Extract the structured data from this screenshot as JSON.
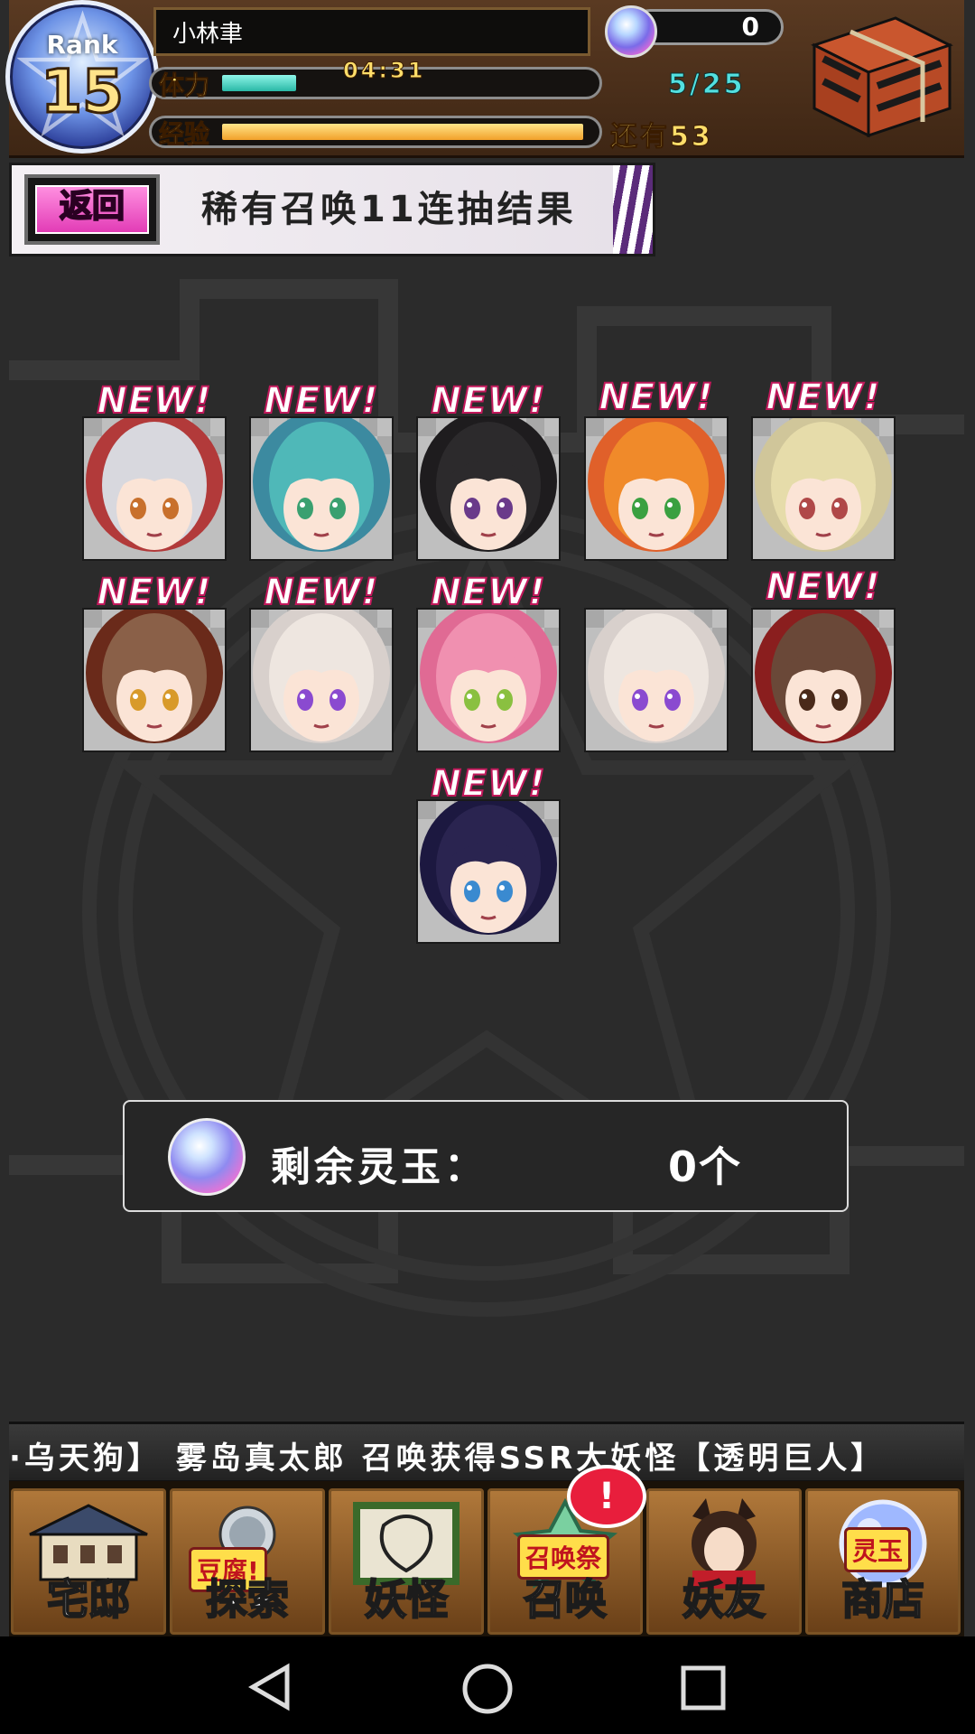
{
  "player": {
    "rank_label": "Rank",
    "rank_value": "15",
    "name": "小林聿",
    "stamina_label": "体力",
    "stamina_timer": "04:31",
    "stamina_value": "5/25",
    "stamina_fraction": 0.2,
    "exp_label": "经验",
    "exp_remaining": "还有53",
    "exp_fraction": 0.98,
    "orb_count": "0"
  },
  "banner": {
    "back_label": "返回",
    "title": "稀有召唤11连抽结果"
  },
  "results": {
    "new_label": "NEW!",
    "cards": [
      {
        "id": "card-1",
        "is_new": true,
        "hair": "#d8d8de",
        "hood": "#b23a3a",
        "eyes": "#c8702c"
      },
      {
        "id": "card-2",
        "is_new": true,
        "hair": "#4fb8b8",
        "hood": "#3c8aa0",
        "eyes": "#3aa070"
      },
      {
        "id": "card-3",
        "is_new": true,
        "hair": "#2c2a2c",
        "hood": "#1e1c1e",
        "eyes": "#6a3a8a"
      },
      {
        "id": "card-4",
        "is_new": true,
        "hair": "#f08a2a",
        "hood": "#e0602a",
        "eyes": "#3aa040"
      },
      {
        "id": "card-5",
        "is_new": true,
        "hair": "#e6dcaa",
        "hood": "#d0c69a",
        "eyes": "#b04848"
      },
      {
        "id": "card-6",
        "is_new": true,
        "hair": "#8a6048",
        "hood": "#6a2a1a",
        "eyes": "#d89a2a"
      },
      {
        "id": "card-7",
        "is_new": true,
        "hair": "#eee6e0",
        "hood": "#d8d0cc",
        "eyes": "#8a4ad0"
      },
      {
        "id": "card-8",
        "is_new": true,
        "hair": "#f090b0",
        "hood": "#e06a94",
        "eyes": "#8ac040"
      },
      {
        "id": "card-9",
        "is_new": false,
        "hair": "#eee6e0",
        "hood": "#d8d0cc",
        "eyes": "#8a4ad0"
      },
      {
        "id": "card-10",
        "is_new": true,
        "hair": "#6a4838",
        "hood": "#8a1e1e",
        "eyes": "#4a2a1a"
      },
      {
        "id": "card-11",
        "is_new": true,
        "hair": "#2a2450",
        "hood": "#1c1840",
        "eyes": "#3a8ad0"
      }
    ]
  },
  "remaining": {
    "label": "剩余灵玉：",
    "value": "0个"
  },
  "ticker": {
    "text": "·乌天狗】    雾岛真太郎 召唤获得SSR大妖怪【透明巨人】"
  },
  "nav": {
    "items": [
      {
        "id": "home",
        "label": "宅邸",
        "tag": ""
      },
      {
        "id": "explore",
        "label": "探索",
        "tag": "豆腐!"
      },
      {
        "id": "yokai",
        "label": "妖怪",
        "tag": ""
      },
      {
        "id": "summon",
        "label": "召唤",
        "tag": "召唤祭"
      },
      {
        "id": "friends",
        "label": "妖友",
        "tag": ""
      },
      {
        "id": "shop",
        "label": "商店",
        "tag": "灵玉"
      }
    ],
    "summon_alert": "!"
  },
  "colors": {
    "new_stroke": "#c2185b",
    "stamina": "#29b8a6",
    "exp": "#f2a12a",
    "back_button": "#e23cb6"
  }
}
